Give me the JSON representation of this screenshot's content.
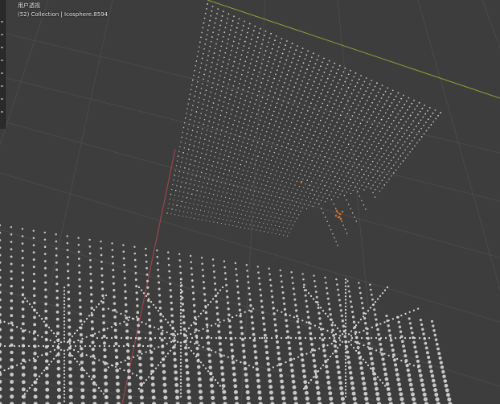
{
  "viewport": {
    "view_name": "用户透视",
    "collection_info": "(52) Collection | Icosphere.8594",
    "background_color": "#3d3d3d",
    "grid_color": "#4a4a4a",
    "x_axis_color": "#9b4450",
    "y_axis_color": "#8aa536",
    "vertex_color": "#c8c8c8",
    "selection_color": "#e07020"
  },
  "toolbar": {
    "tools": [
      "select-icon",
      "cursor-icon",
      "move-icon",
      "rotate-icon",
      "scale-icon",
      "transform-icon",
      "annotate-icon",
      "measure-icon"
    ]
  }
}
